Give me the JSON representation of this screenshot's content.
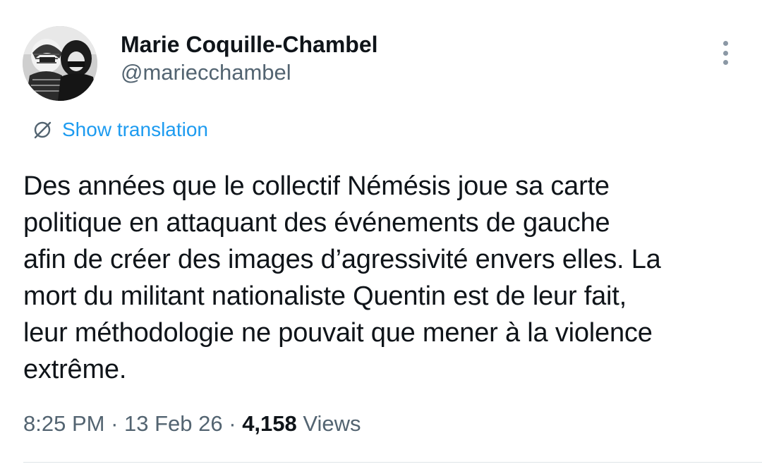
{
  "author": {
    "display_name": "Marie Coquille-Chambel",
    "handle": "@mariecchambel",
    "avatar_icon": "profile-photo"
  },
  "more_icon": "more-vertical-icon",
  "translation": {
    "icon": "translate-globe-icon",
    "label": "Show translation",
    "color": "#1d9bf0"
  },
  "tweet": {
    "lines": [
      "Des années que le collectif Némésis joue sa carte",
      "politique en attaquant des événements de gauche",
      "afin de créer des images d’agressivité envers elles. La",
      "mort du militant nationaliste Quentin est de leur fait,",
      "leur méthodologie ne pouvait que mener à la violence",
      "extrême."
    ]
  },
  "meta": {
    "time": "8:25 PM",
    "separator": " · ",
    "date": "13 Feb 26",
    "views_count": "4,158",
    "views_label": " Views"
  },
  "colors": {
    "text": "#0f1419",
    "secondary": "#536471",
    "accent": "#1d9bf0"
  }
}
